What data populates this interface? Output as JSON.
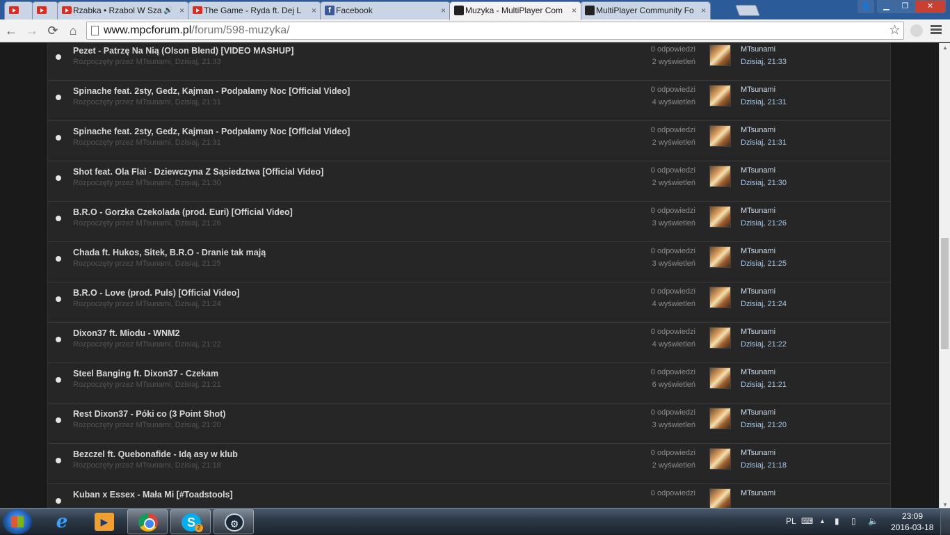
{
  "browser": {
    "tabs": [
      {
        "title": "",
        "icon": "youtube-icon",
        "width": 42
      },
      {
        "title": "",
        "icon": "youtube-icon",
        "width": 38
      },
      {
        "title": "Rzabka • Rzabol W Sza",
        "icon": "youtube-icon",
        "speaker": "🔊",
        "width": 190
      },
      {
        "title": "The Game - Ryda ft. Dej L",
        "icon": "youtube-icon",
        "width": 192
      },
      {
        "title": "Facebook",
        "icon": "facebook-icon",
        "width": 188
      },
      {
        "title": "Muzyka - MultiPlayer Com",
        "icon": "mpc-icon",
        "width": 190,
        "active": true
      },
      {
        "title": "MultiPlayer Community Fo",
        "icon": "mpc-icon",
        "width": 188
      }
    ],
    "url_host": "www.mpcforum.pl",
    "url_path": "/forum/598-muzyka/"
  },
  "topics": [
    {
      "title": "Pezet - Patrzę Na Nią (Olson Blend) [VIDEO MASHUP]",
      "meta": "Rozpoczęty przez MTsunami, Dzisiaj, 21:33",
      "replies": "0 odpowiedzi",
      "views": "2 wyświetleń",
      "last_user": "MTsunami",
      "last_date": "Dzisiaj, 21:33"
    },
    {
      "title": "Spinache feat. 2sty, Gedz, Kajman - Podpalamy Noc [Official Video]",
      "meta": "Rozpoczęty przez MTsunami, Dzisiaj, 21:31",
      "replies": "0 odpowiedzi",
      "views": "4 wyświetleń",
      "last_user": "MTsunami",
      "last_date": "Dzisiaj, 21:31"
    },
    {
      "title": "Spinache feat. 2sty, Gedz, Kajman - Podpalamy Noc [Official Video]",
      "meta": "Rozpoczęty przez MTsunami, Dzisiaj, 21:31",
      "replies": "0 odpowiedzi",
      "views": "2 wyświetleń",
      "last_user": "MTsunami",
      "last_date": "Dzisiaj, 21:31"
    },
    {
      "title": "Shot feat. Ola Flai - Dziewczyna Z Sąsiedztwa [Official Video]",
      "meta": "Rozpoczęty przez MTsunami, Dzisiaj, 21:30",
      "replies": "0 odpowiedzi",
      "views": "2 wyświetleń",
      "last_user": "MTsunami",
      "last_date": "Dzisiaj, 21:30"
    },
    {
      "title": "B.R.O - Gorzka Czekolada (prod. Euri) [Official Video]",
      "meta": "Rozpoczęty przez MTsunami, Dzisiaj, 21:26",
      "replies": "0 odpowiedzi",
      "views": "3 wyświetleń",
      "last_user": "MTsunami",
      "last_date": "Dzisiaj, 21:26"
    },
    {
      "title": "Chada ft. Hukos, Sitek, B.R.O - Dranie tak mają",
      "meta": "Rozpoczęty przez MTsunami, Dzisiaj, 21:25",
      "replies": "0 odpowiedzi",
      "views": "3 wyświetleń",
      "last_user": "MTsunami",
      "last_date": "Dzisiaj, 21:25"
    },
    {
      "title": "B.R.O - Love (prod. Puls) [Official Video]",
      "meta": "Rozpoczęty przez MTsunami, Dzisiaj, 21:24",
      "replies": "0 odpowiedzi",
      "views": "4 wyświetleń",
      "last_user": "MTsunami",
      "last_date": "Dzisiaj, 21:24"
    },
    {
      "title": "Dixon37 ft. Miodu - WNM2",
      "meta": "Rozpoczęty przez MTsunami, Dzisiaj, 21:22",
      "replies": "0 odpowiedzi",
      "views": "4 wyświetleń",
      "last_user": "MTsunami",
      "last_date": "Dzisiaj, 21:22"
    },
    {
      "title": "Steel Banging ft. Dixon37 - Czekam",
      "meta": "Rozpoczęty przez MTsunami, Dzisiaj, 21:21",
      "replies": "0 odpowiedzi",
      "views": "6 wyświetleń",
      "last_user": "MTsunami",
      "last_date": "Dzisiaj, 21:21"
    },
    {
      "title": "Rest Dixon37 - Póki co (3 Point Shot)",
      "meta": "Rozpoczęty przez MTsunami, Dzisiaj, 21:20",
      "replies": "0 odpowiedzi",
      "views": "3 wyświetleń",
      "last_user": "MTsunami",
      "last_date": "Dzisiaj, 21:20"
    },
    {
      "title": "Bezczel ft. Quebonafide - Idą asy w klub",
      "meta": "Rozpoczęty przez MTsunami, Dzisiaj, 21:18",
      "replies": "0 odpowiedzi",
      "views": "2 wyświetleń",
      "last_user": "MTsunami",
      "last_date": "Dzisiaj, 21:18"
    },
    {
      "title": "Kuban x Essex - Mała Mi [#Toadstools]",
      "meta": "",
      "replies": "0 odpowiedzi",
      "views": "",
      "last_user": "MTsunami",
      "last_date": ""
    }
  ],
  "taskbar": {
    "language": "PL",
    "time": "23:09",
    "date": "2016-03-18",
    "skype_badge": "2"
  }
}
